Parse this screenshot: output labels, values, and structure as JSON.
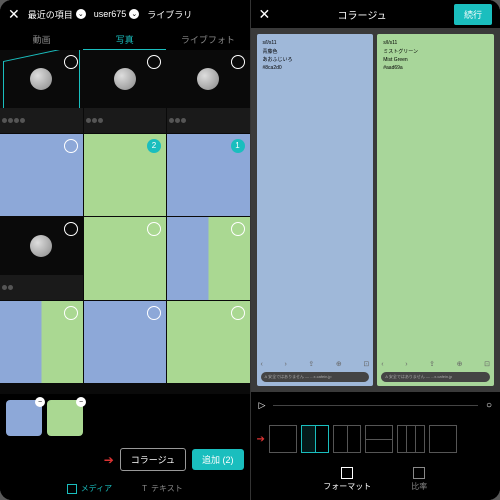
{
  "left": {
    "header": {
      "recent": "最近の項目",
      "user": "user675",
      "library": "ライブラリ"
    },
    "tabs": {
      "video": "動画",
      "photo": "写真",
      "livephoto": "ライブフォト"
    },
    "badges": {
      "b1": "2",
      "b2": "1"
    },
    "actions": {
      "collage": "コラージュ",
      "add": "追加 (2)"
    },
    "bottomNav": {
      "media": "メディア",
      "text": "テキスト"
    }
  },
  "right": {
    "header": {
      "title": "コラージュ",
      "continue": "続行"
    },
    "cards": {
      "blue": {
        "code": "s/l/s11",
        "name1": "青藤色",
        "name2": "あおふじいろ",
        "hex": "#8ca2d0"
      },
      "green": {
        "code": "s/l/s11",
        "name1": "ミストグリーン",
        "name2": "Mist Green",
        "hex": "#aad69a"
      }
    },
    "url": "安全ではありません — ...x.cafein.jp",
    "bottomTabs": {
      "format": "フォーマット",
      "ratio": "比率"
    }
  }
}
